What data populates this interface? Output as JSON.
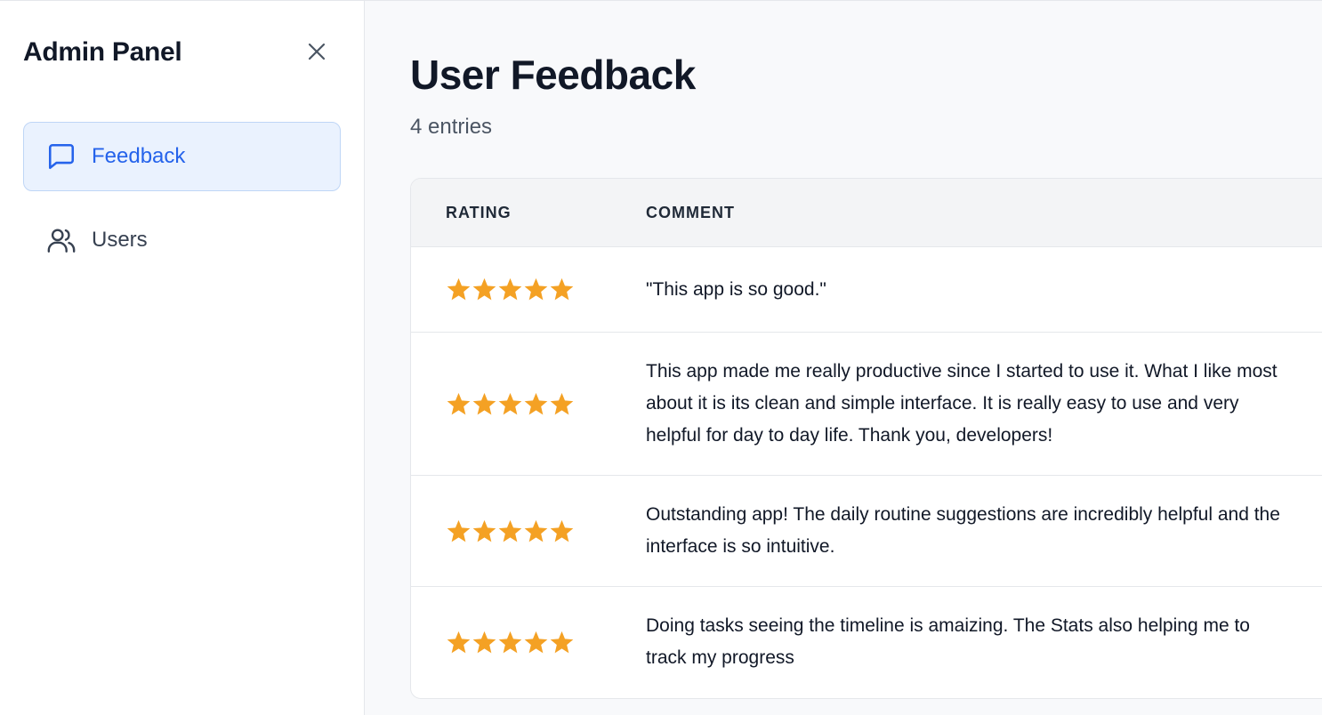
{
  "sidebar": {
    "title": "Admin Panel",
    "close_icon": "close-icon",
    "items": [
      {
        "label": "Feedback",
        "icon": "message-square-icon",
        "active": true
      },
      {
        "label": "Users",
        "icon": "users-icon",
        "active": false
      }
    ]
  },
  "main": {
    "title": "User Feedback",
    "entries_text": "4 entries",
    "table": {
      "headers": [
        "RATING",
        "COMMENT"
      ],
      "star_color": "#f4a124",
      "rows": [
        {
          "rating": 5,
          "comment": "\"This app is so good.\""
        },
        {
          "rating": 5,
          "comment": "This app made me really productive since I started to use it. What I like most about it is its clean and simple interface. It is really easy to use and very helpful for day to day life. Thank you, developers!"
        },
        {
          "rating": 5,
          "comment": "Outstanding app! The daily routine suggestions are incredibly helpful and the interface is so intuitive."
        },
        {
          "rating": 5,
          "comment": "Doing tasks seeing the timeline is amaizing. The Stats also helping me to track my progress"
        }
      ]
    }
  },
  "colors": {
    "accent": "#2563eb",
    "active_bg": "#eaf2fe"
  }
}
